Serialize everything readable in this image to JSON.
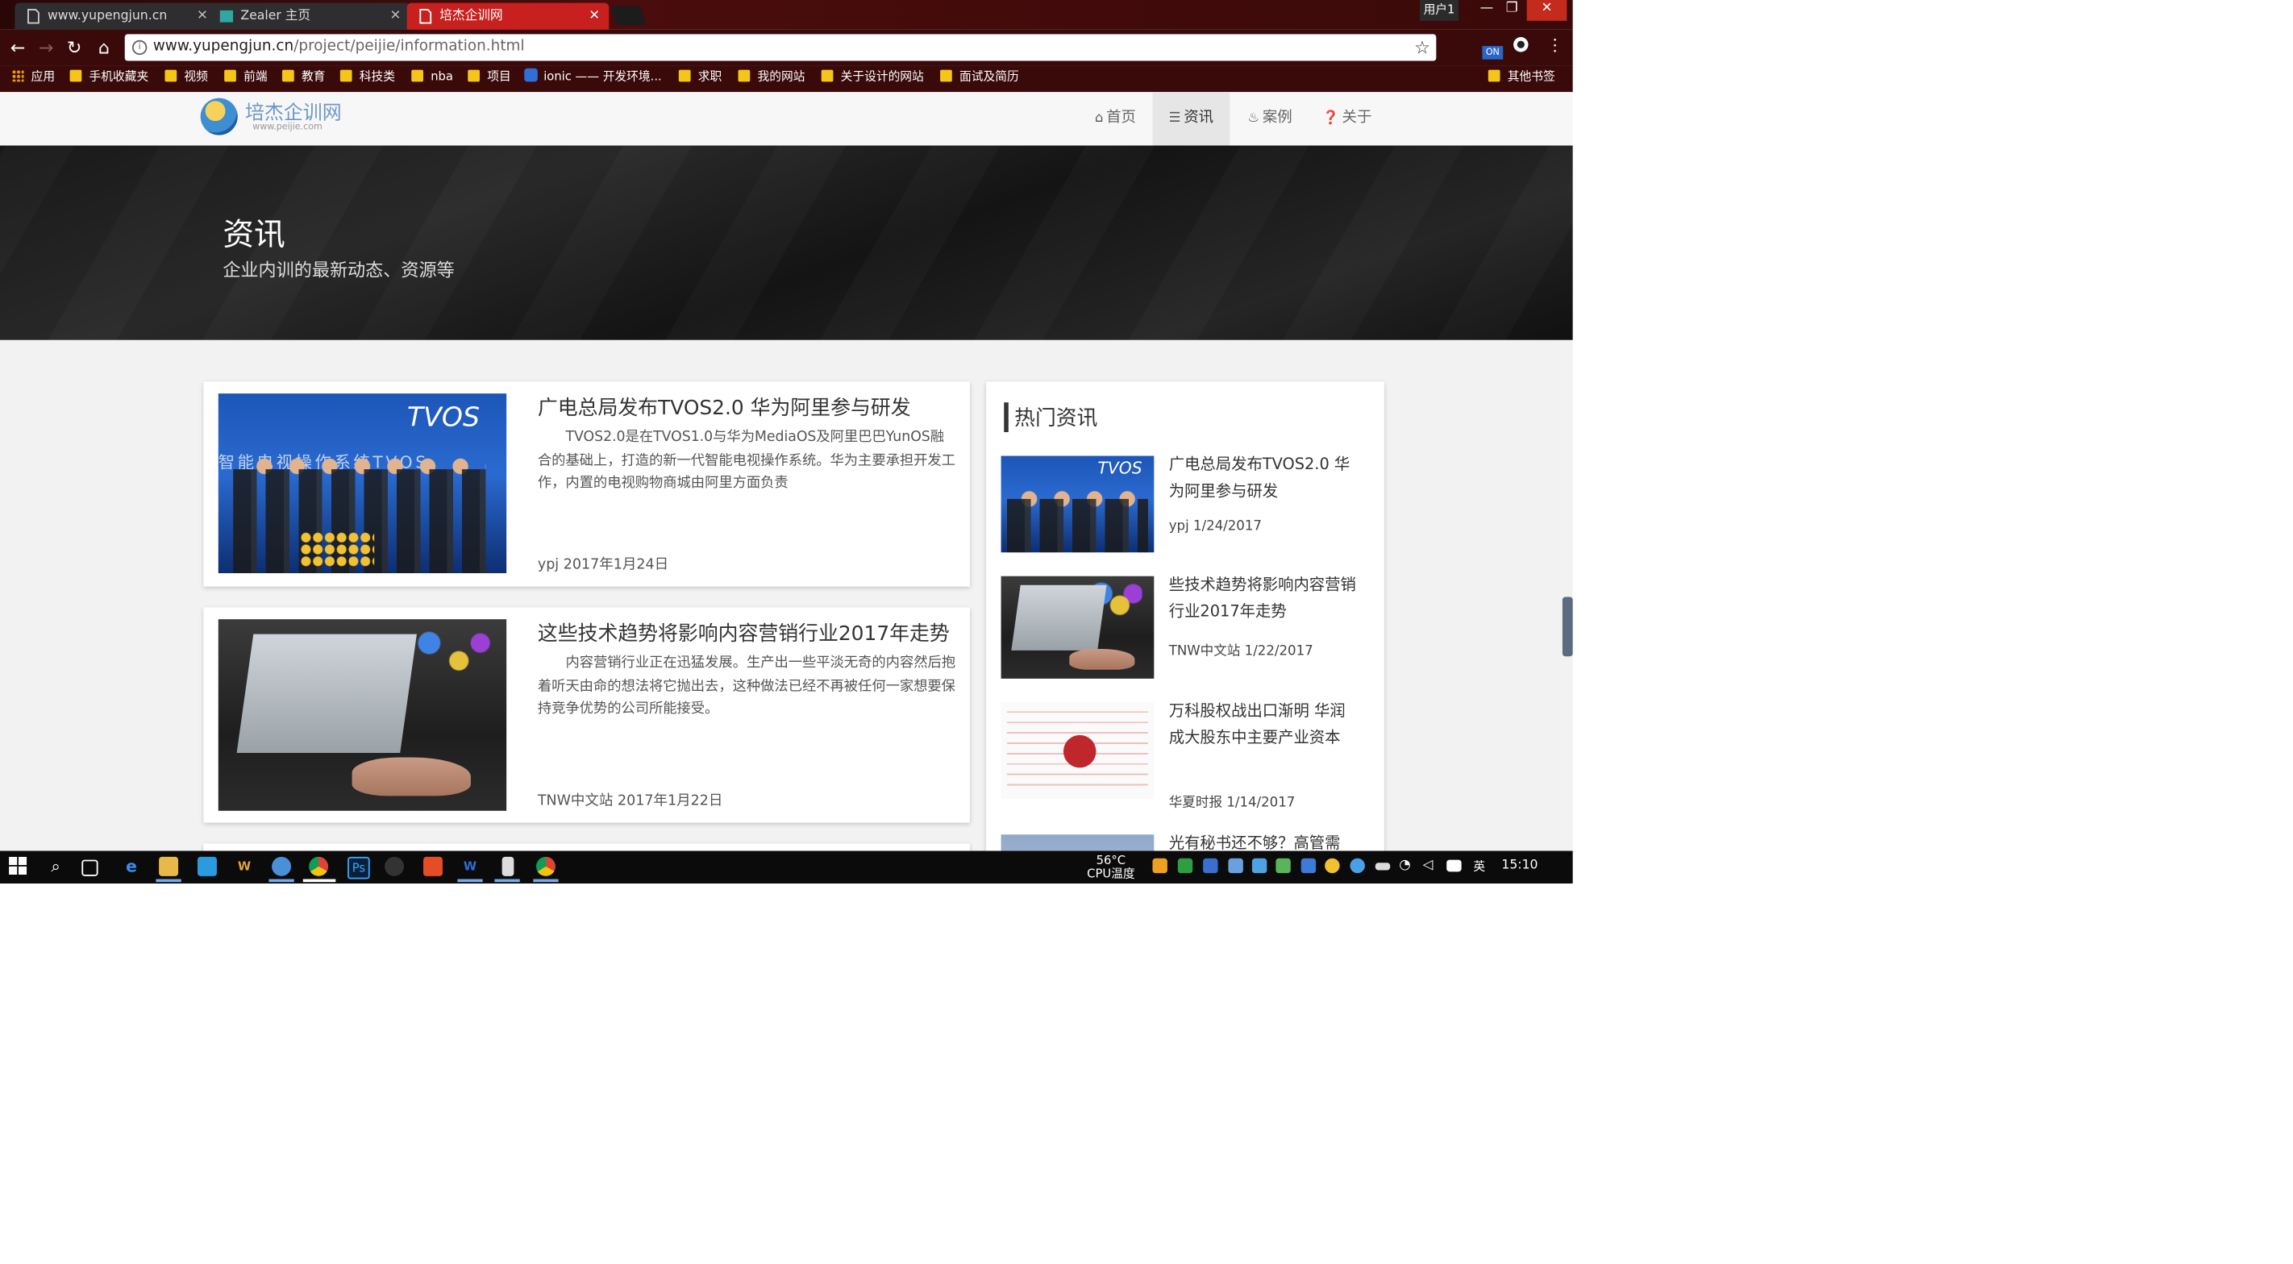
{
  "browser": {
    "tabs": [
      {
        "title": "www.yupengjun.cn",
        "active": false
      },
      {
        "title": "Zealer 主页",
        "active": false
      },
      {
        "title": "培杰企训网",
        "active": true
      }
    ],
    "profile": "用户1",
    "url_host": "www.yupengjun.cn",
    "url_path": "/project/peijie/information.html",
    "bookmarks": [
      "应用",
      "手机收藏夹",
      "视频",
      "前端",
      "教育",
      "科技类",
      "nba",
      "项目",
      "ionic —— 开发环境...",
      "求职",
      "我的网站",
      "关于设计的网站",
      "面试及简历",
      "其他书签"
    ],
    "ext_badge": "ON"
  },
  "site": {
    "logo_title": "培杰企训网",
    "logo_url": "www.peijie.com",
    "nav": [
      {
        "label": "首页",
        "icon": "home-icon",
        "active": false
      },
      {
        "label": "资讯",
        "icon": "list-icon",
        "active": true
      },
      {
        "label": "案例",
        "icon": "fire-icon",
        "active": false
      },
      {
        "label": "关于",
        "icon": "question-circle-icon",
        "active": false
      }
    ]
  },
  "banner": {
    "title": "资讯",
    "subtitle": "企业内训的最新动态、资源等"
  },
  "articles": [
    {
      "title": "广电总局发布TVOS2.0 华为阿里参与研发",
      "desc": "TVOS2.0是在TVOS1.0与华为MediaOS及阿里巴巴YunOS融合的基础上，打造的新一代智能电视操作系统。华为主要承担开发工作，内置的电视购物商城由阿里方面负责",
      "meta": "ypj 2017年1月24日",
      "thumb_text": "TVOS",
      "thumb_strip": "智能电视操作系统TVOS"
    },
    {
      "title": "这些技术趋势将影响内容营销行业2017年走势",
      "desc": "内容营销行业正在迅猛发展。生产出一些平淡无奇的内容然后抱着听天由命的想法将它抛出去，这种做法已经不再被任何一家想要保持竞争优势的公司所能接受。",
      "meta": "TNW中文站 2017年1月22日"
    }
  ],
  "sidebar": {
    "heading": "热门资讯",
    "items": [
      {
        "title": "广电总局发布TVOS2.0 华为阿里参与研发",
        "meta": "ypj 1/24/2017"
      },
      {
        "title": "些技术趋势将影响内容营销行业2017年走势",
        "meta": "TNW中文站 1/22/2017"
      },
      {
        "title": "万科股权战出口渐明 华润成大股东中主要产业资本",
        "meta": "华夏时报 1/14/2017"
      },
      {
        "title": "光有秘书还不够？高管需"
      }
    ]
  },
  "taskbar": {
    "temp": "56°C",
    "temp_label": "CPU温度",
    "ime": "英",
    "time": "15:10"
  },
  "colors": {
    "active_tab": "#c7201f",
    "browser_chrome": "#3a0a0a",
    "banner": "#1f1f1f",
    "logo_text": "#6e98c9"
  }
}
